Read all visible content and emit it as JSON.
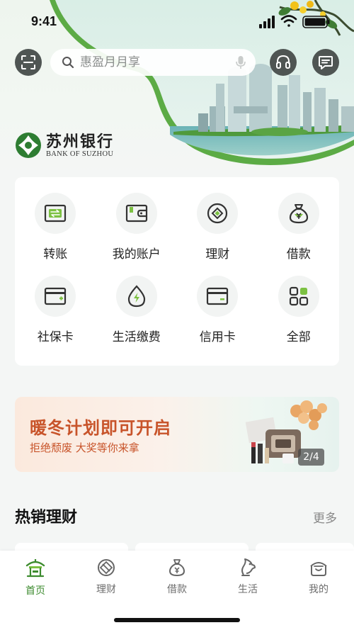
{
  "status_bar": {
    "time": "9:41"
  },
  "search": {
    "placeholder": "惠盈月月享"
  },
  "logo": {
    "name_cn": "苏州银行",
    "name_en": "BANK OF SUZHOU"
  },
  "menu": {
    "items": [
      {
        "label": "转账",
        "icon": "transfer-icon"
      },
      {
        "label": "我的账户",
        "icon": "wallet-icon"
      },
      {
        "label": "理财",
        "icon": "wealth-icon"
      },
      {
        "label": "借款",
        "icon": "loan-bag-icon"
      },
      {
        "label": "社保卡",
        "icon": "social-card-icon"
      },
      {
        "label": "生活缴费",
        "icon": "utility-drop-icon"
      },
      {
        "label": "信用卡",
        "icon": "credit-card-icon"
      },
      {
        "label": "全部",
        "icon": "grid-icon"
      }
    ]
  },
  "banner": {
    "title": "暖冬计划即可开启",
    "subtitle": "拒绝颓废  大奖等你来拿",
    "pager": "2/4"
  },
  "hot_section": {
    "title": "热销理财",
    "more": "更多"
  },
  "tabs": [
    {
      "label": "首页",
      "icon": "home-pavilion-icon",
      "active": true
    },
    {
      "label": "理财",
      "icon": "wealth-tab-icon",
      "active": false
    },
    {
      "label": "借款",
      "icon": "loan-tab-icon",
      "active": false
    },
    {
      "label": "生活",
      "icon": "life-tab-icon",
      "active": false
    },
    {
      "label": "我的",
      "icon": "profile-tab-icon",
      "active": false
    }
  ],
  "colors": {
    "brand_green": "#3d8b2f",
    "banner_text": "#c8542a",
    "icon_dark": "#4f5553"
  }
}
